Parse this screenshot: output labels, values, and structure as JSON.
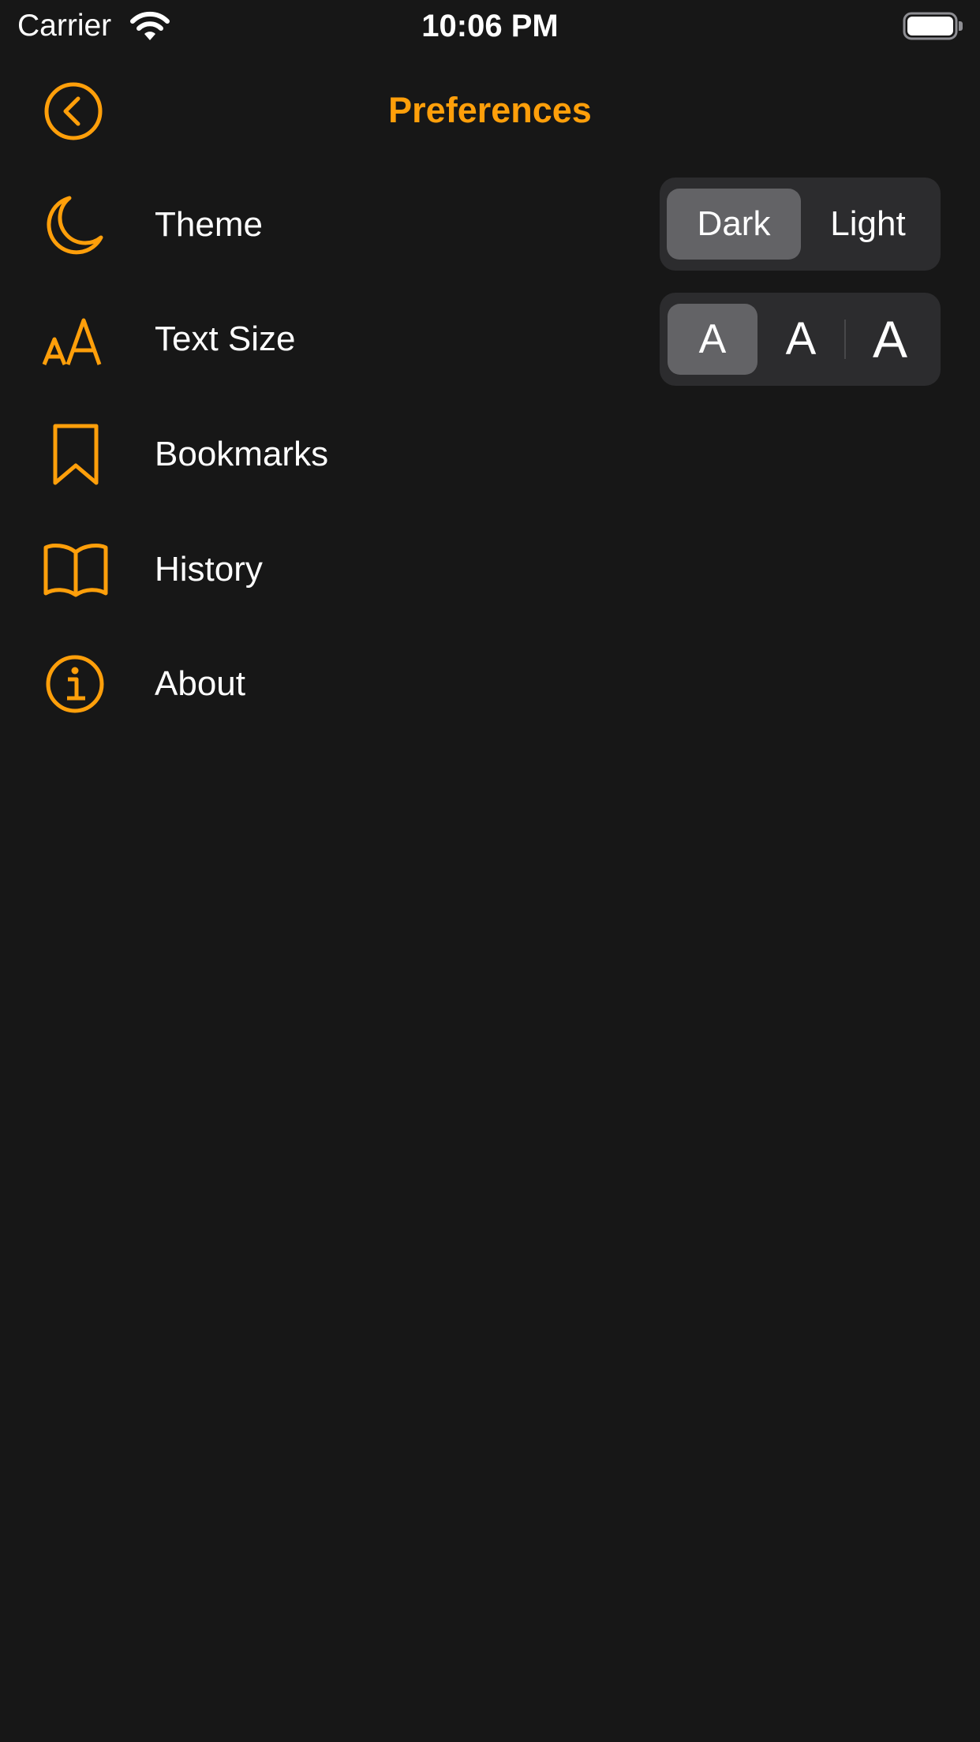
{
  "status_bar": {
    "carrier": "Carrier",
    "time": "10:06 PM"
  },
  "nav": {
    "title": "Preferences"
  },
  "settings": {
    "items": [
      {
        "label": "Theme",
        "icon": "moon-icon"
      },
      {
        "label": "Text Size",
        "icon": "text-size-icon"
      },
      {
        "label": "Bookmarks",
        "icon": "bookmark-icon"
      },
      {
        "label": "History",
        "icon": "book-icon"
      },
      {
        "label": "About",
        "icon": "info-icon"
      }
    ]
  },
  "theme_control": {
    "options": [
      "Dark",
      "Light"
    ],
    "selected": "Dark"
  },
  "text_size_control": {
    "options": [
      "A",
      "A",
      "A"
    ],
    "selected_index": 0
  },
  "colors": {
    "accent": "#ff9f0a",
    "background": "#171717",
    "control_background": "#2c2c2e",
    "control_selected": "#636366",
    "text": "#ffffff"
  }
}
